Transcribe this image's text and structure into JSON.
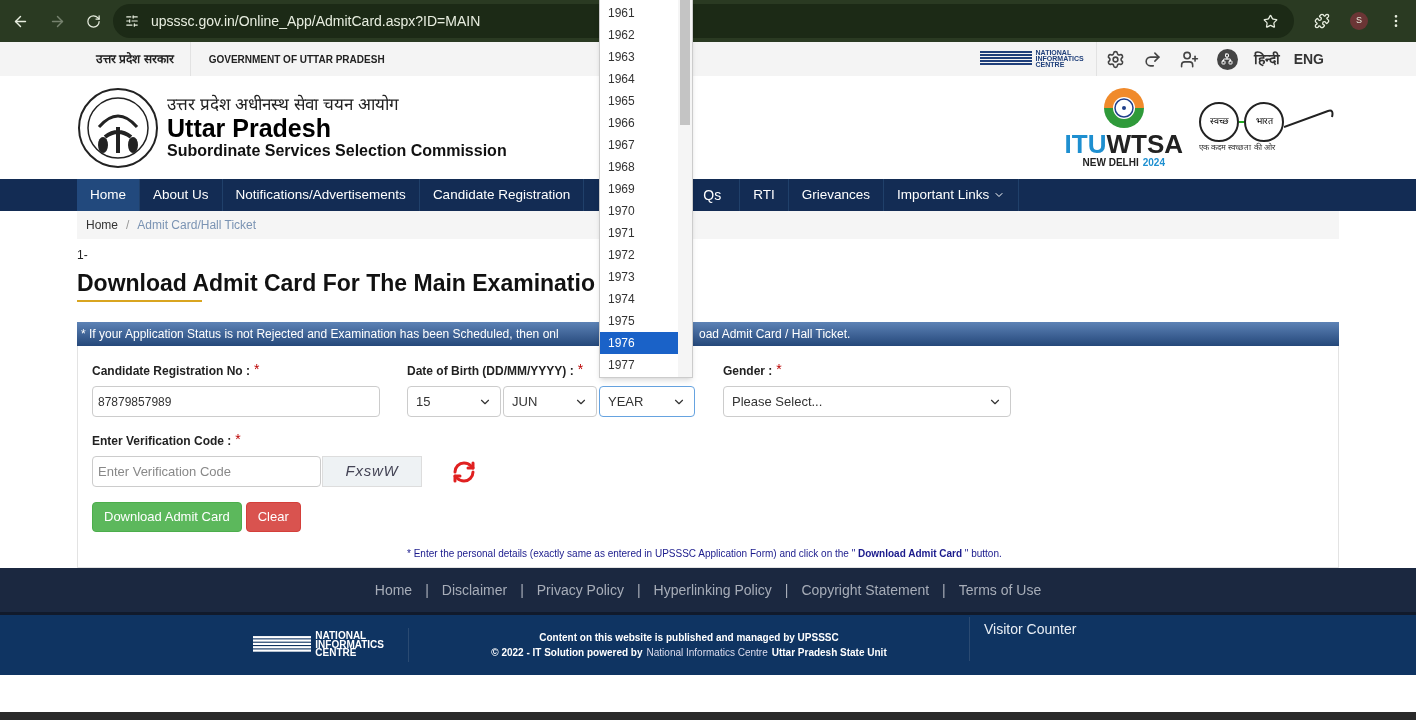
{
  "browser": {
    "url": "upsssc.gov.in/Online_App/AdmitCard.aspx?ID=MAIN",
    "profile_initial": "S"
  },
  "topbar": {
    "hindi_title": "उत्तर प्रदेश सरकार",
    "english_title": "GOVERNMENT OF UTTAR PRADESH",
    "nic": [
      "NATIONAL",
      "INFORMATICS",
      "CENTRE"
    ],
    "languages": [
      "हिन्दी",
      "ENG"
    ]
  },
  "header": {
    "hindi_name": "उत्तर प्रदेश अधीनस्थ सेवा चयन आयोग",
    "name": "Uttar Pradesh",
    "subtitle": "Subordinate Services Selection Commission",
    "itu": {
      "part_a": "ITU",
      "part_b": "WTSA",
      "city": "NEW DELHI",
      "year": "2024"
    },
    "swachh": {
      "left": "स्वच्छ",
      "right": "भारत",
      "tagline": "एक कदम स्वच्छता की ओर"
    }
  },
  "nav": [
    {
      "label": "Home",
      "selected": true,
      "has_menu": false
    },
    {
      "label": "About Us",
      "selected": false,
      "has_menu": false
    },
    {
      "label": "Notifications/Advertisements",
      "selected": false,
      "has_menu": false
    },
    {
      "label": "Candidate Registration",
      "selected": false,
      "has_menu": false
    },
    {
      "label": "Qs",
      "selected": false,
      "has_menu": false,
      "covered": true
    },
    {
      "label": "RTI",
      "selected": false,
      "has_menu": false
    },
    {
      "label": "Grievances",
      "selected": false,
      "has_menu": false
    },
    {
      "label": "Important Links",
      "selected": false,
      "has_menu": true
    }
  ],
  "breadcrumb": [
    "Home",
    "Admit Card/Hall Ticket"
  ],
  "breadcrumb_separator": "/",
  "index": "1-",
  "title": "Download Admit Card For The Main Examinatio",
  "notice": {
    "left": "* If your Application Status is not Rejected and Examination has been Scheduled, then onl",
    "right": "oad Admit Card / Hall Ticket."
  },
  "form": {
    "registration": {
      "label": "Candidate Registration No :",
      "value": "87879857989"
    },
    "dob": {
      "label": "Date of Birth (DD/MM/YYYY) :",
      "day": "15",
      "month": "JUN",
      "year": "YEAR"
    },
    "gender": {
      "label": "Gender :",
      "value": "Please Select..."
    },
    "verification": {
      "label": "Enter Verification Code :",
      "placeholder": "Enter Verification Code",
      "captcha_text": "FxswW"
    },
    "required_mark": "*",
    "buttons": [
      "Download Admit Card",
      "Clear"
    ],
    "note": "* Enter the personal details (exactly same as entered in UPSSSC Application Form) and click on the \" **Download Admit Card** \" button."
  },
  "year_dropdown": [
    {
      "label": "1961",
      "selected": false
    },
    {
      "label": "1962",
      "selected": false
    },
    {
      "label": "1963",
      "selected": false
    },
    {
      "label": "1964",
      "selected": false
    },
    {
      "label": "1965",
      "selected": false
    },
    {
      "label": "1966",
      "selected": false
    },
    {
      "label": "1967",
      "selected": false
    },
    {
      "label": "1968",
      "selected": false
    },
    {
      "label": "1969",
      "selected": false
    },
    {
      "label": "1970",
      "selected": false
    },
    {
      "label": "1971",
      "selected": false
    },
    {
      "label": "1972",
      "selected": false
    },
    {
      "label": "1973",
      "selected": false
    },
    {
      "label": "1974",
      "selected": false
    },
    {
      "label": "1975",
      "selected": false
    },
    {
      "label": "1976",
      "selected": true
    },
    {
      "label": "1977",
      "selected": false
    }
  ],
  "footer": {
    "links": [
      "Home",
      "Disclaimer",
      "Privacy Policy",
      "Hyperlinking Policy",
      "Copyright Statement",
      "Terms of Use"
    ],
    "link_separator": "|",
    "nic": [
      "NATIONAL",
      "INFORMATICS",
      "CENTRE"
    ],
    "line1": "Content on this website is published and managed by UPSSSC",
    "line2_before": "© 2022 - IT Solution powered by",
    "line2_link": "National Informatics Centre",
    "line2_after": "Uttar Pradesh State Unit",
    "visitor": "Visitor Counter"
  }
}
